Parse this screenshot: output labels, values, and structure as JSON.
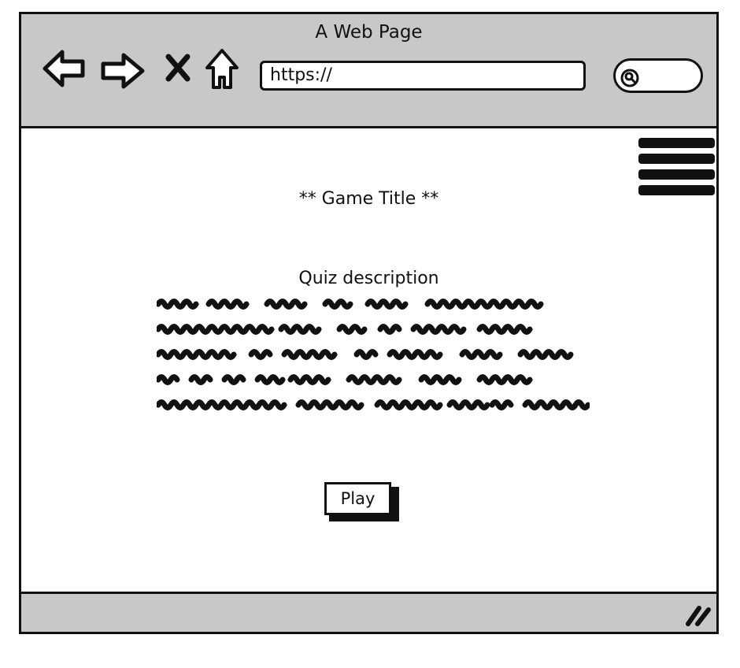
{
  "window": {
    "title": "A Web Page"
  },
  "toolbar": {
    "back_icon": "back-arrow-icon",
    "forward_icon": "forward-arrow-icon",
    "stop_icon": "close-icon",
    "home_icon": "home-icon",
    "url_value": "https://",
    "search_icon": "search-icon"
  },
  "content": {
    "menu_icon": "hamburger-menu-icon",
    "game_title": "** Game Title **",
    "quiz_heading": "Quiz description",
    "play_label": "Play"
  },
  "statusbar": {
    "grip_icon": "resize-grip-icon"
  },
  "colors": {
    "chrome": "#c8c8c8",
    "ink": "#111111",
    "background": "#ffffff"
  }
}
